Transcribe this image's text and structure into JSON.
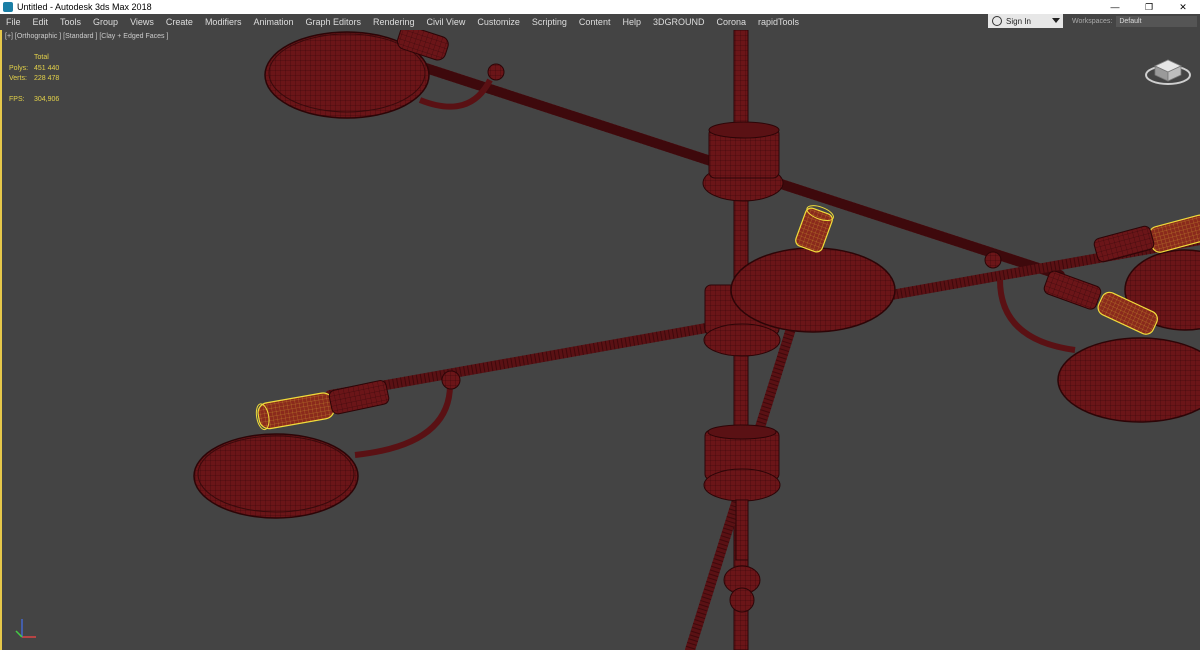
{
  "window": {
    "title": "Untitled - Autodesk 3ds Max 2018",
    "icon": "3dsmax-app-icon",
    "controls": {
      "minimize": "—",
      "maximize": "❐",
      "close": "✕"
    }
  },
  "menu": {
    "items": [
      "File",
      "Edit",
      "Tools",
      "Group",
      "Views",
      "Create",
      "Modifiers",
      "Animation",
      "Graph Editors",
      "Rendering",
      "Civil View",
      "Customize",
      "Scripting",
      "Content",
      "Help",
      "3DGROUND",
      "Corona",
      "rapidTools"
    ]
  },
  "account": {
    "sign_in_label": "Sign In"
  },
  "workspaces": {
    "label": "Workspaces:",
    "value": "Default"
  },
  "viewport": {
    "label": "[+] [Orthographic ] [Standard ] [Clay + Edged Faces ]",
    "stats": {
      "header": "Total",
      "polys_label": "Polys:",
      "polys_value": "451 440",
      "verts_label": "Verts:",
      "verts_value": "228 478",
      "fps_label": "FPS:",
      "fps_value": "304,906"
    }
  },
  "colors": {
    "viewport_bg": "#444444",
    "clay": "#6b1518",
    "clay_dark": "#4a0e10",
    "selection": "#f0dc3a",
    "stats_text": "#e4d24a"
  }
}
